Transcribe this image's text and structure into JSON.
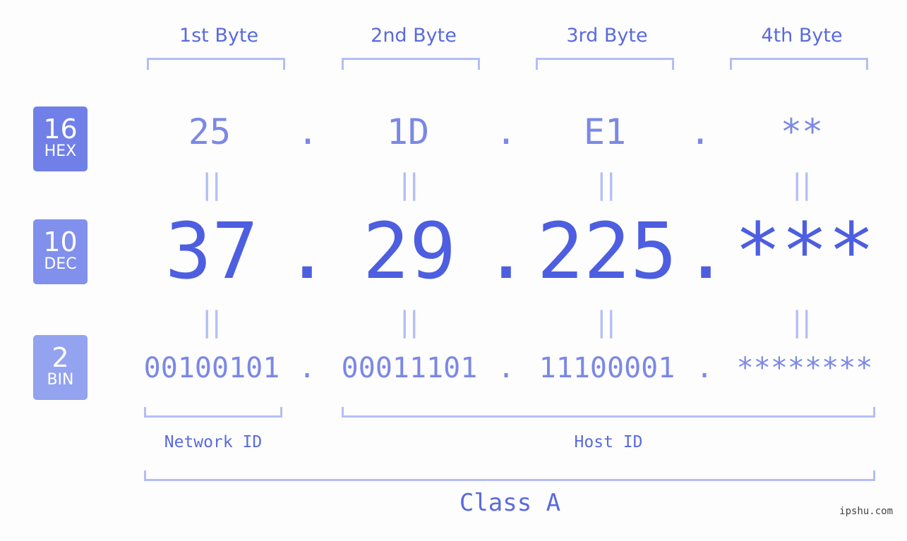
{
  "byte_headers": [
    "1st Byte",
    "2nd Byte",
    "3rd Byte",
    "4th Byte"
  ],
  "badges": {
    "hex": {
      "number": "16",
      "label": "HEX",
      "color": "#7080e8"
    },
    "dec": {
      "number": "10",
      "label": "DEC",
      "color": "#8190ec"
    },
    "bin": {
      "number": "2",
      "label": "BIN",
      "color": "#93a3f0"
    }
  },
  "hex_values": [
    "25",
    "1D",
    "E1",
    "**"
  ],
  "dec_values": [
    "37",
    "29",
    "225",
    "***"
  ],
  "bin_values": [
    "00100101",
    "00011101",
    "11100001",
    "********"
  ],
  "separator": ".",
  "equals_glyph": "||",
  "network_id_label": "Network ID",
  "host_id_label": "Host ID",
  "class_label": "Class A",
  "watermark": "ipshu.com"
}
